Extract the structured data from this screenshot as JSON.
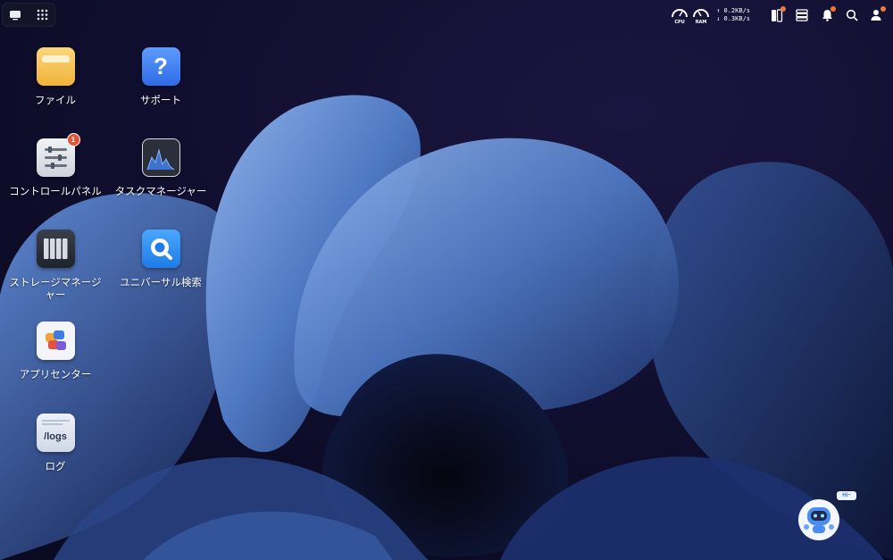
{
  "launcher": {
    "show_desktop_icon": "monitor-icon",
    "apps_icon": "grid-dots-icon"
  },
  "topbar": {
    "cpu_label": "CPU",
    "ram_label": "RAM",
    "upload_rate": "↑ 0.2KB/s",
    "download_rate": "↓ 0.3KB/s",
    "icons": [
      "tasks-icon",
      "storage-list-icon",
      "bell-icon",
      "search-icon",
      "user-icon"
    ]
  },
  "desktop": {
    "files": "ファイル",
    "support": "サポート",
    "control_panel": "コントロールパネル",
    "control_panel_badge": "1",
    "task_manager": "タスクマネージャー",
    "storage_manager": "ストレージマネージャー",
    "universal_search": "ユニバーサル検索",
    "app_center": "アプリセンター",
    "logs": "ログ",
    "logs_tile_text": "/logs",
    "support_glyph": "?"
  },
  "assistant": {
    "bubble": "Hi~"
  },
  "colors": {
    "accent": "#3b82f6",
    "badge": "#e25433",
    "notify_dot": "#f07a34",
    "background": "#100f2e"
  }
}
